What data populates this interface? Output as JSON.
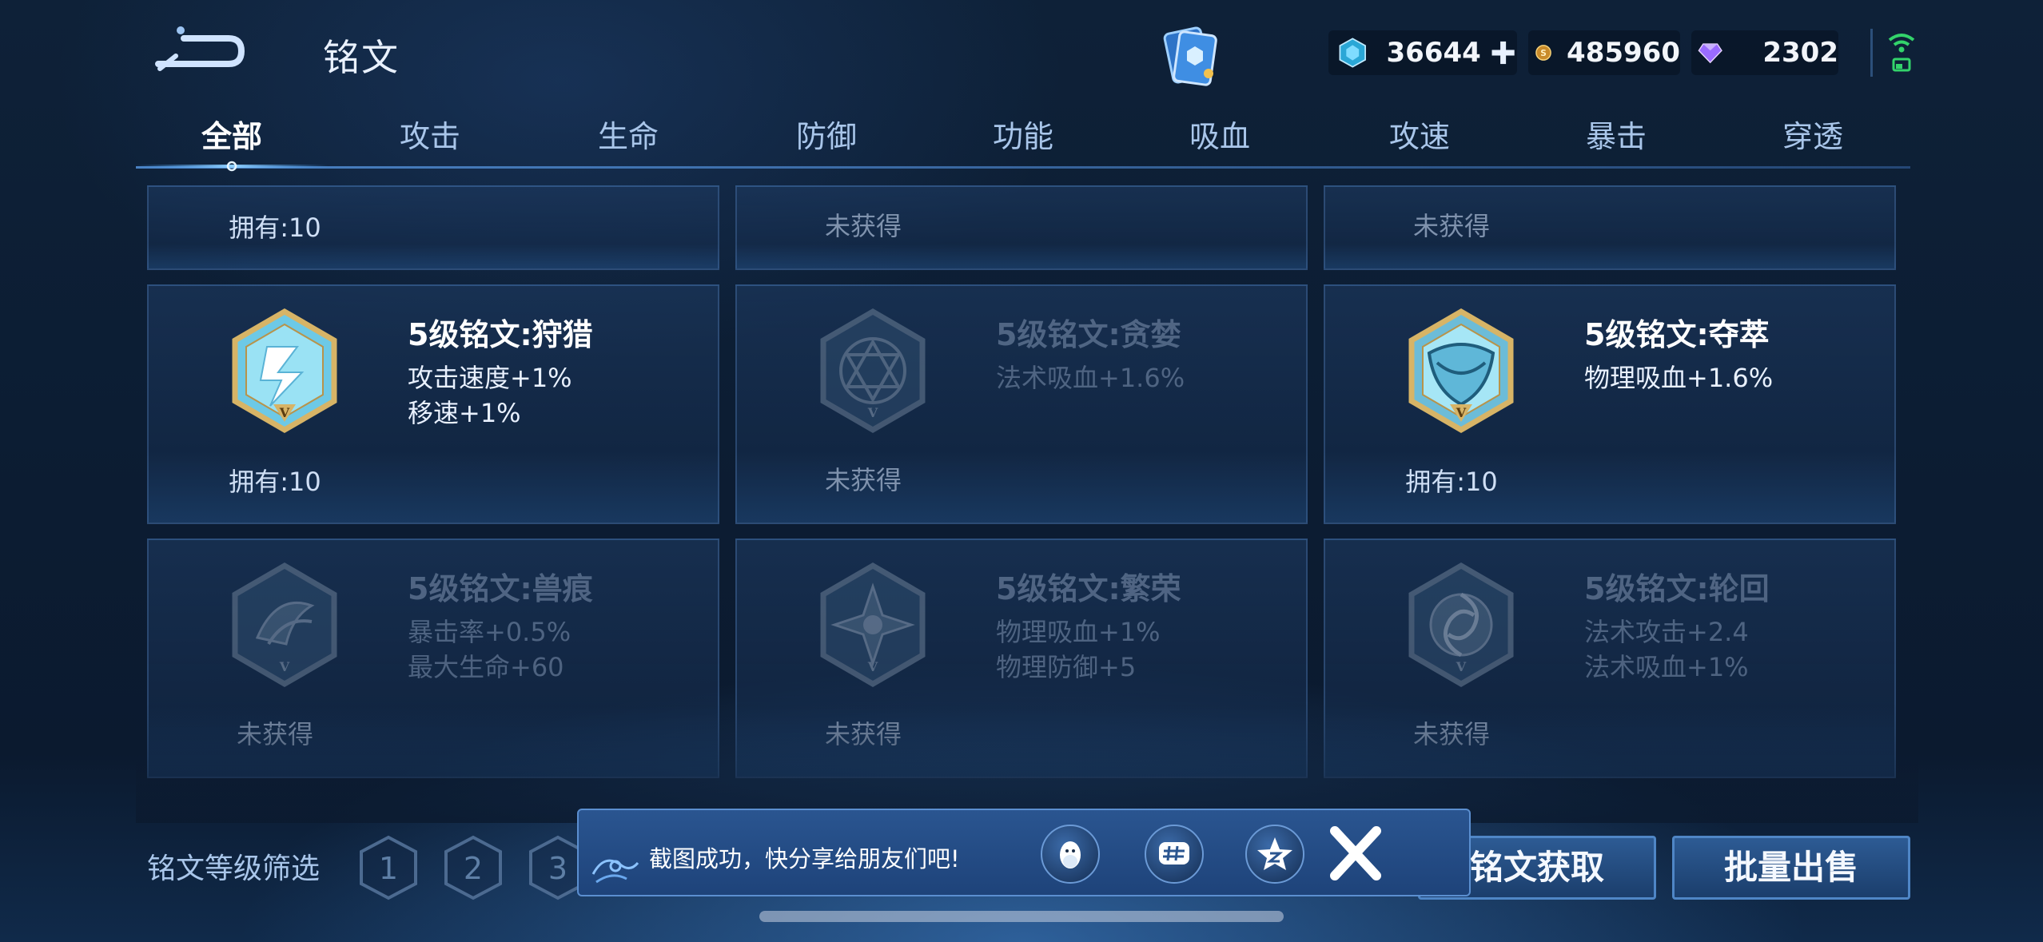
{
  "header": {
    "title": "铭文",
    "currencies": [
      {
        "icon": "blue-crystal-icon",
        "value": "36644"
      },
      {
        "icon": "gold-coin-icon",
        "value": "485960"
      },
      {
        "icon": "purple-diamond-icon",
        "value": "2302"
      }
    ]
  },
  "tabs": [
    "全部",
    "攻击",
    "生命",
    "防御",
    "功能",
    "吸血",
    "攻速",
    "暴击",
    "穿透"
  ],
  "active_tab": "全部",
  "top_row": [
    "拥有:10",
    "未获得",
    "未获得"
  ],
  "cards": [
    {
      "name": "5级铭文:狩猎",
      "stats": [
        "攻击速度+1%",
        "移速+1%"
      ],
      "owned": "拥有:10",
      "locked": false,
      "icon": "hunt-rune-icon"
    },
    {
      "name": "5级铭文:贪婪",
      "stats": [
        "法术吸血+1.6%"
      ],
      "owned": "未获得",
      "locked": true,
      "icon": "greed-rune-icon"
    },
    {
      "name": "5级铭文:夺萃",
      "stats": [
        "物理吸血+1.6%"
      ],
      "owned": "拥有:10",
      "locked": false,
      "icon": "plunder-rune-icon"
    },
    {
      "name": "5级铭文:兽痕",
      "stats": [
        "暴击率+0.5%",
        "最大生命+60"
      ],
      "owned": "未获得",
      "locked": true,
      "icon": "beast-mark-rune-icon"
    },
    {
      "name": "5级铭文:繁荣",
      "stats": [
        "物理吸血+1%",
        "物理防御+5"
      ],
      "owned": "未获得",
      "locked": true,
      "icon": "prosperity-rune-icon"
    },
    {
      "name": "5级铭文:轮回",
      "stats": [
        "法术攻击+2.4",
        "法术吸血+1%"
      ],
      "owned": "未获得",
      "locked": true,
      "icon": "reincarnation-rune-icon"
    }
  ],
  "filter": {
    "label": "铭文等级筛选",
    "levels": [
      "1",
      "2",
      "3"
    ]
  },
  "buttons": {
    "acquire": "铭文获取",
    "bulk_sell": "批量出售"
  },
  "toast": {
    "message": "截图成功，快分享给朋友们吧!",
    "share_targets": [
      "qq-icon",
      "hash-topic-icon",
      "qzone-star-icon"
    ]
  },
  "colors": {
    "accent": "#4f86c6",
    "rune_gold": "#c9a65a",
    "rune_cyan": "#7fd4ef"
  }
}
